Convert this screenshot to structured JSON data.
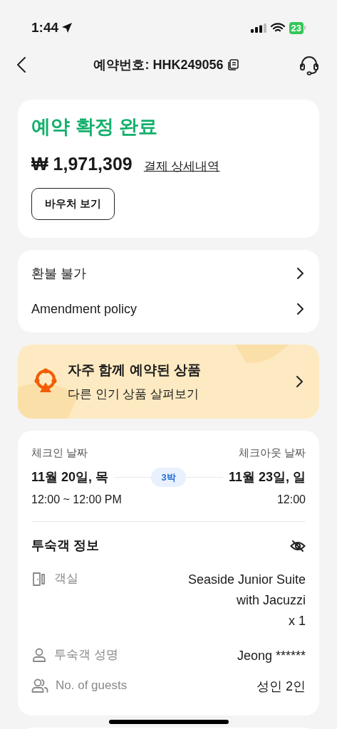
{
  "status_bar": {
    "time": "1:44",
    "battery": "23"
  },
  "header": {
    "title": "예약번호: HHK249056"
  },
  "summary": {
    "status": "예약 확정 완료",
    "price": "₩ 1,971,309",
    "price_link": "결제 상세내역",
    "voucher_button": "바우처 보기"
  },
  "policies": [
    {
      "label": "환불 불가"
    },
    {
      "label": "Amendment policy"
    }
  ],
  "promo": {
    "title": "자주 함께 예약된 상품",
    "subtitle": "다른 인기 상품 살펴보기"
  },
  "stay": {
    "checkin_label": "체크인 날짜",
    "checkout_label": "체크아웃 날짜",
    "checkin_date": "11월 20일, 목",
    "checkout_date": "11월 23일, 일",
    "nights": "3박",
    "checkin_time": "12:00 ~ 12:00 PM",
    "checkout_time": "12:00"
  },
  "guest_info": {
    "title": "투숙객 정보",
    "rows": [
      {
        "kind": "room",
        "label": "객실",
        "value": "Seaside Junior Suite with Jacuzzi",
        "quantity": "x 1"
      },
      {
        "kind": "person",
        "label": "투숙객 성명",
        "value": "Jeong ******"
      },
      {
        "kind": "guests",
        "label": "No. of guests",
        "value": "성인 2인"
      }
    ]
  }
}
